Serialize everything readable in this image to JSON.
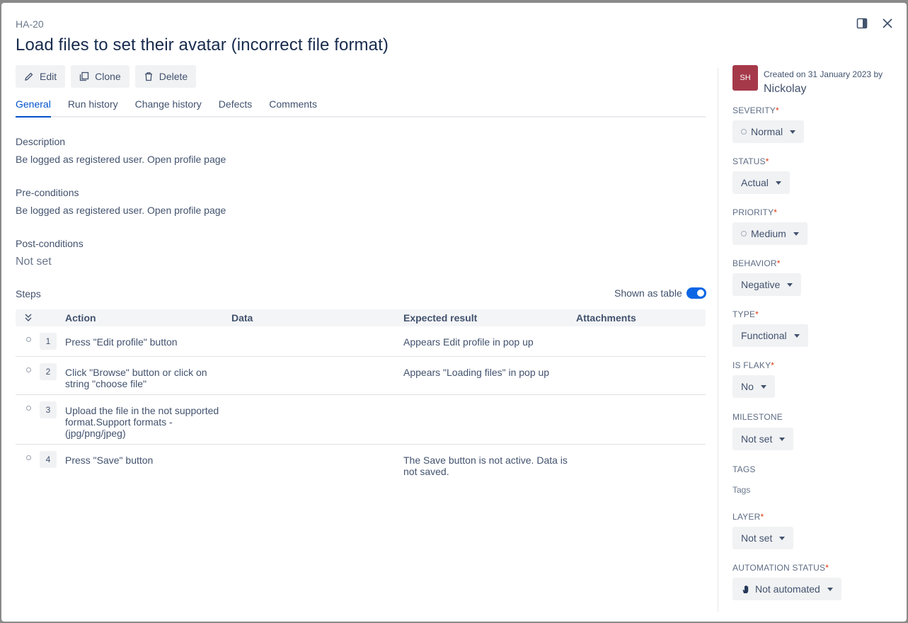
{
  "header": {
    "issue_key": "HA-20",
    "title": "Load files to set their avatar (incorrect file format)"
  },
  "toolbar": {
    "edit_label": "Edit",
    "clone_label": "Clone",
    "delete_label": "Delete"
  },
  "tabs": [
    {
      "label": "General",
      "active": true
    },
    {
      "label": "Run history"
    },
    {
      "label": "Change history"
    },
    {
      "label": "Defects"
    },
    {
      "label": "Comments"
    }
  ],
  "description": {
    "label": "Description",
    "text": "Be logged as registered user. Open profile page"
  },
  "preconditions": {
    "label": "Pre-conditions",
    "text": "Be logged as registered user. Open profile page"
  },
  "postconditions": {
    "label": "Post-conditions",
    "text": "Not set"
  },
  "steps": {
    "label": "Steps",
    "shown_as_table_label": "Shown as table",
    "shown_as_table": true,
    "columns": {
      "action": "Action",
      "data": "Data",
      "expected": "Expected result",
      "attachments": "Attachments"
    },
    "rows": [
      {
        "num": "1",
        "action": "Press \"Edit profile\" button",
        "data": "",
        "expected": "Appears Edit profile in pop up"
      },
      {
        "num": "2",
        "action": "Click \"Browse\" button or click on string \"choose file\"",
        "data": "",
        "expected": "Appears \"Loading files\" in pop up"
      },
      {
        "num": "3",
        "action": "Upload the file in the not supported format.Support formats - (jpg/png/jpeg)",
        "data": "",
        "expected": ""
      },
      {
        "num": "4",
        "action": "Press \"Save\" button",
        "data": "",
        "expected": "The Save button is not active. Data is not saved."
      }
    ]
  },
  "sidebar": {
    "avatar_initials": "SH",
    "avatar_color": "#a5394a",
    "created_text": "Created on 31 January 2023 by",
    "author": "Nickolay",
    "fields": {
      "severity": {
        "label": "SEVERITY",
        "value": "Normal"
      },
      "status": {
        "label": "STATUS",
        "value": "Actual"
      },
      "priority": {
        "label": "PRIORITY",
        "value": "Medium"
      },
      "behavior": {
        "label": "BEHAVIOR",
        "value": "Negative"
      },
      "type": {
        "label": "TYPE",
        "value": "Functional"
      },
      "is_flaky": {
        "label": "IS FLAKY",
        "value": "No"
      },
      "milestone": {
        "label": "MILESTONE",
        "value": "Not set"
      },
      "tags": {
        "label": "TAGS",
        "placeholder": "Tags"
      },
      "layer": {
        "label": "LAYER",
        "value": "Not set"
      },
      "automation_status": {
        "label": "AUTOMATION STATUS",
        "value": "Not automated"
      }
    }
  },
  "colors": {
    "accent": "#0052cc",
    "required": "#de350b"
  }
}
